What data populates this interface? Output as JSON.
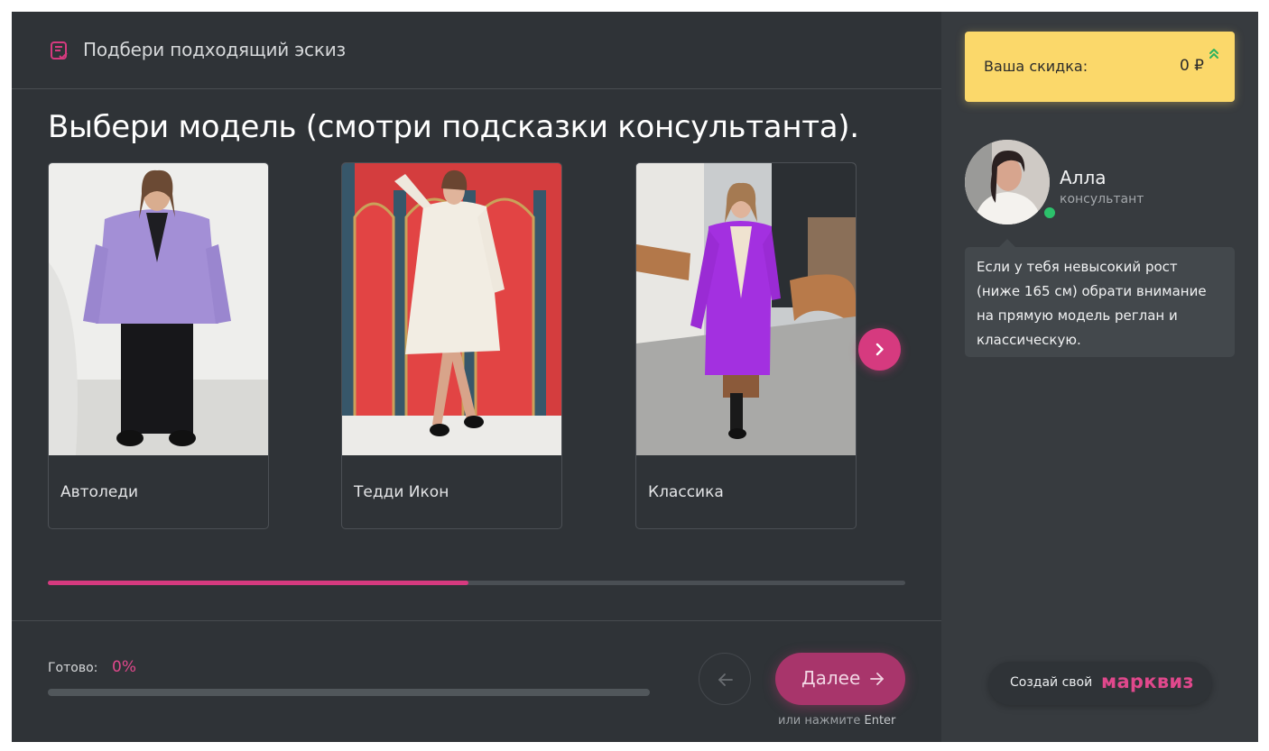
{
  "header": {
    "title": "Подбери подходящий эскиз",
    "icon": "checklist-icon"
  },
  "question": "Выбери модель (смотри подсказки консультанта).",
  "cards": [
    {
      "label": "Автоледи",
      "coat_color": "#a38fd6"
    },
    {
      "label": "Тедди Икон",
      "coat_color": "#f2ede3"
    },
    {
      "label": "Классика",
      "coat_color": "#a330e0"
    }
  ],
  "carousel": {
    "progress": 0.49
  },
  "footer": {
    "ready_label": "Готово:",
    "ready_value": "0%",
    "ready_progress": 0,
    "next_label": "Далее",
    "hint_prefix": "или нажмите",
    "hint_key": "Enter"
  },
  "sidebar": {
    "discount_label": "Ваша скидка:",
    "discount_value": "0 ₽",
    "consultant_name": "Алла",
    "consultant_role": "консультант",
    "consultant_message": "Если у тебя невысокий рост (ниже 165 см) обрати внимание на прямую модель реглан и классическую.",
    "create_text": "Создай свой",
    "create_brand": "марквиз"
  },
  "colors": {
    "accent": "#d63a7f",
    "discount_bg": "#fbd86a",
    "online": "#2cc16b"
  }
}
